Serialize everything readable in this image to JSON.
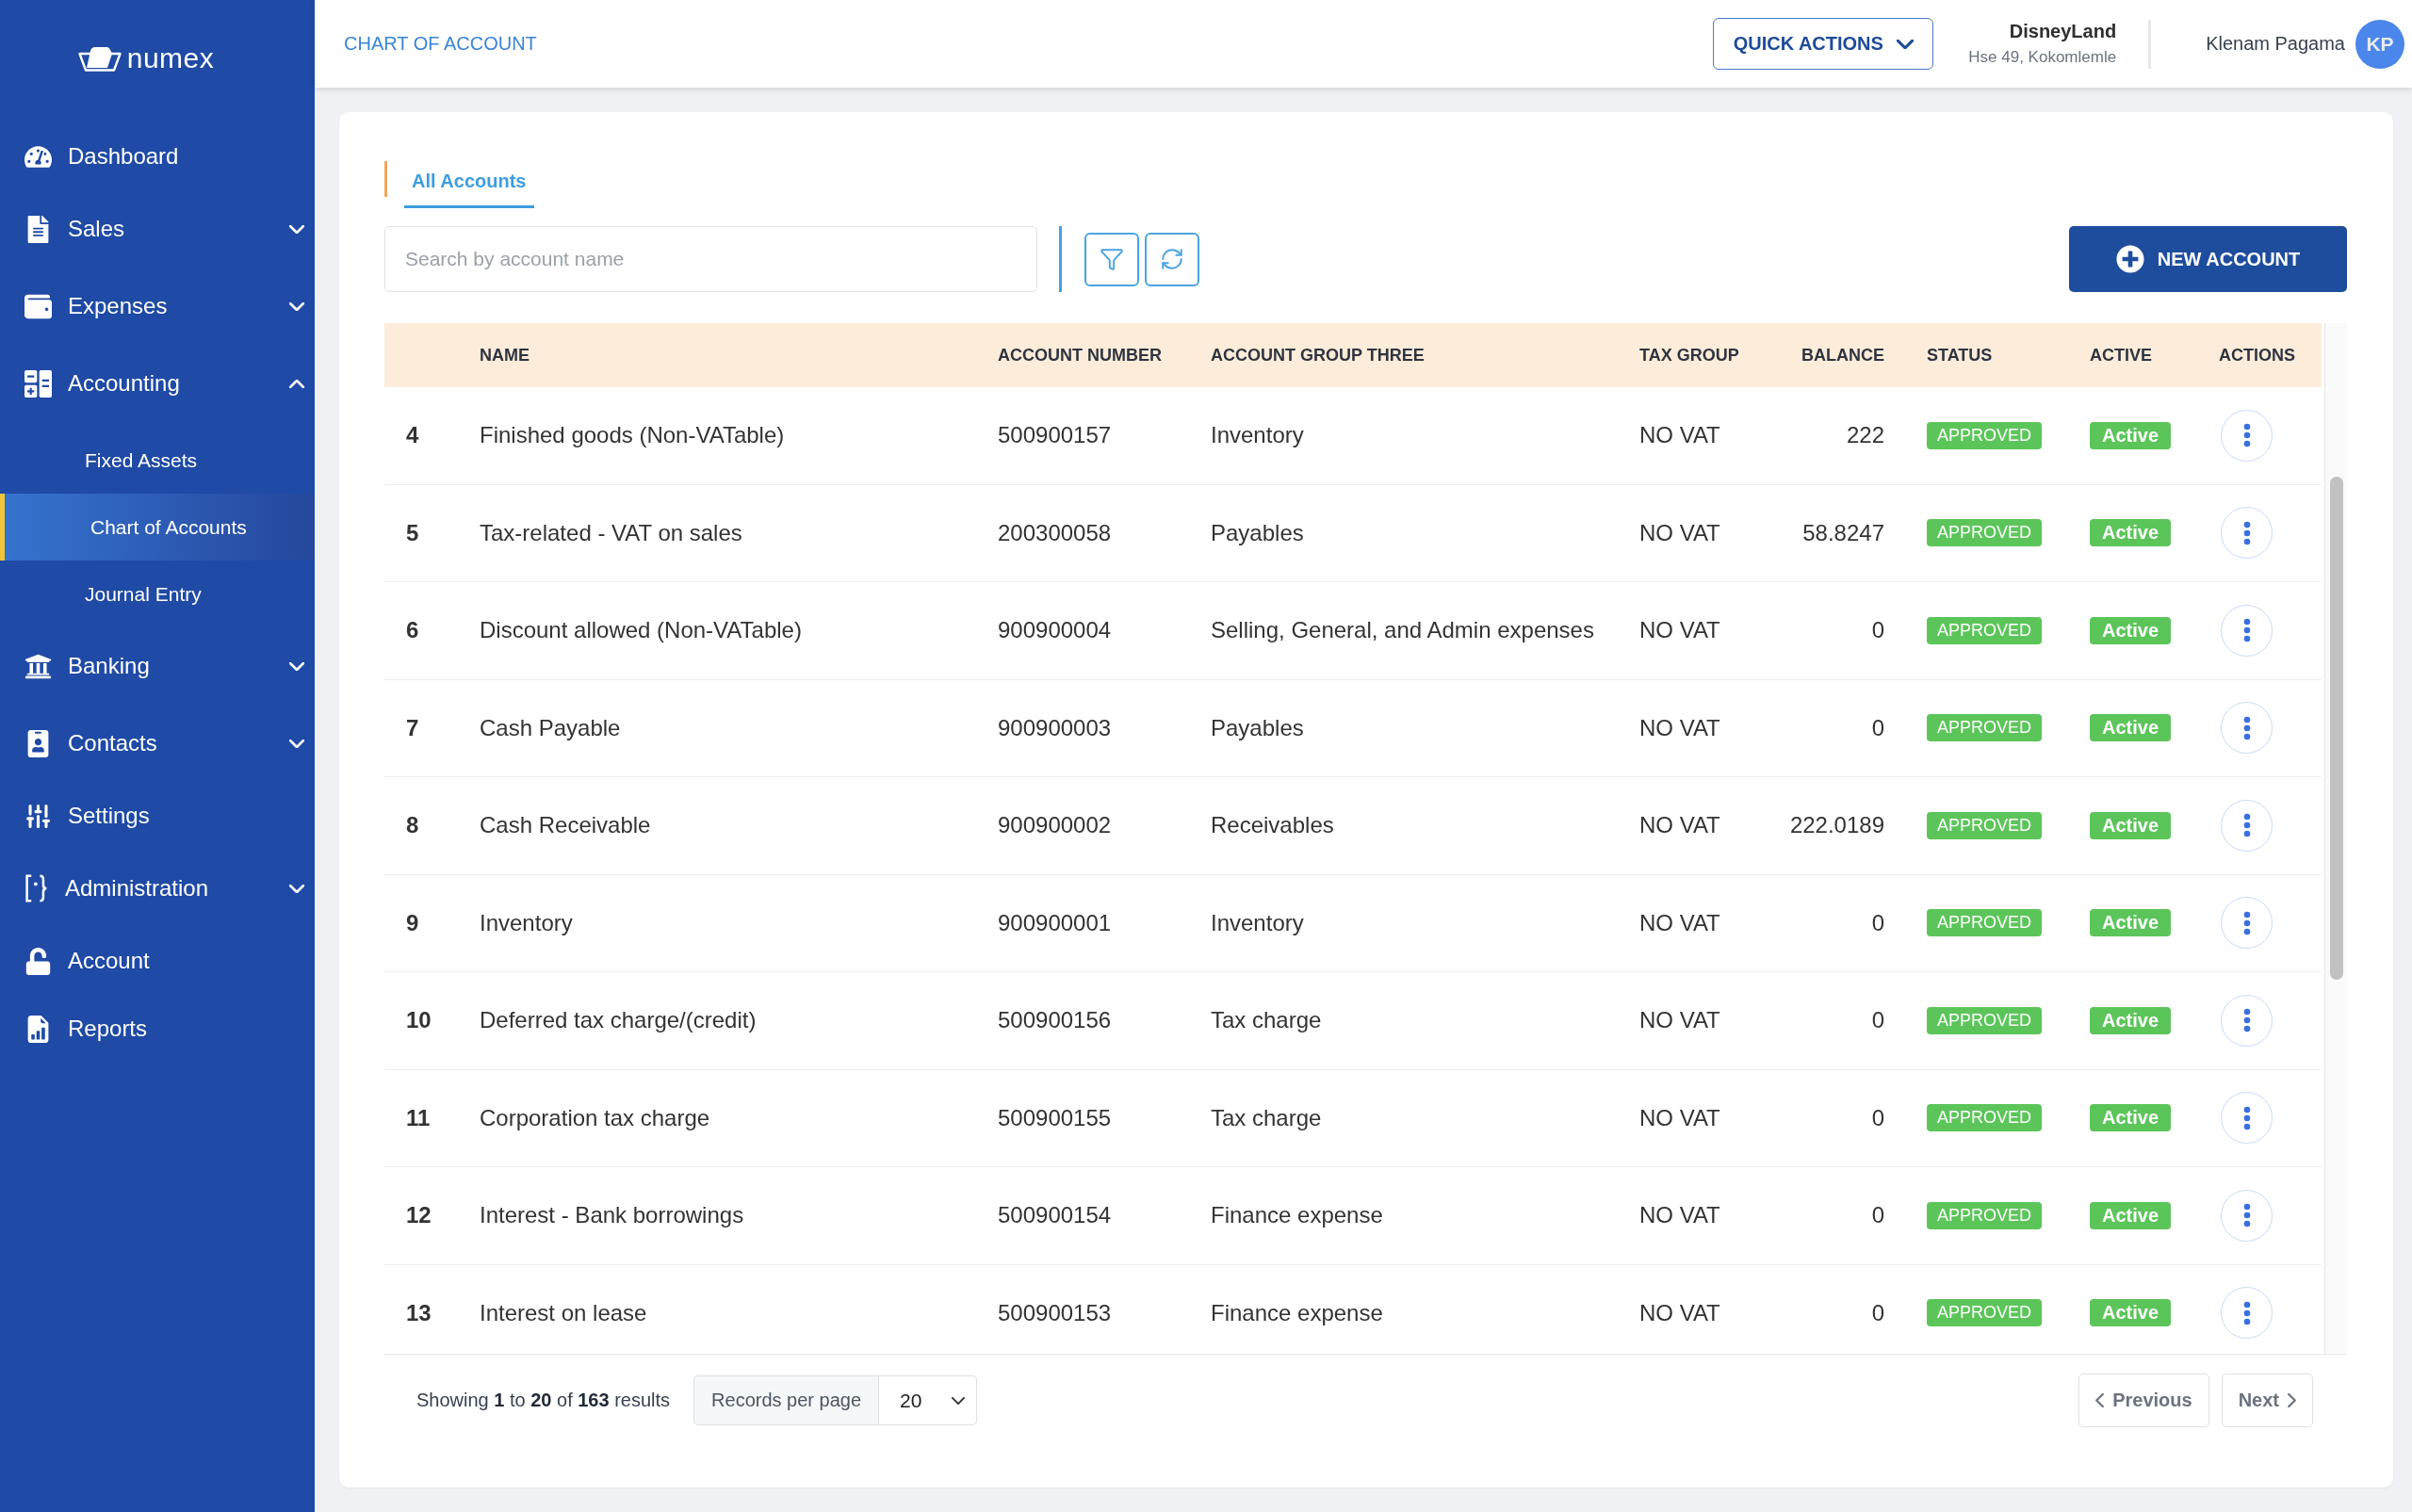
{
  "sidebar": {
    "brand": "numex",
    "items": [
      {
        "label": "Dashboard",
        "kind": "link"
      },
      {
        "label": "Sales",
        "kind": "group",
        "expanded": false
      },
      {
        "label": "Expenses",
        "kind": "group",
        "expanded": false
      },
      {
        "label": "Accounting",
        "kind": "group",
        "expanded": true,
        "children": [
          {
            "label": "Fixed Assets",
            "selected": false
          },
          {
            "label": "Chart of Accounts",
            "selected": true
          },
          {
            "label": "Journal Entry",
            "selected": false
          }
        ]
      },
      {
        "label": "Banking",
        "kind": "group",
        "expanded": false
      },
      {
        "label": "Contacts",
        "kind": "group",
        "expanded": false
      },
      {
        "label": "Settings",
        "kind": "link"
      },
      {
        "label": "Administration",
        "kind": "group",
        "expanded": false
      },
      {
        "label": "Account",
        "kind": "link"
      },
      {
        "label": "Reports",
        "kind": "link"
      }
    ]
  },
  "header": {
    "title": "CHART OF ACCOUNT",
    "quick_actions": "QUICK ACTIONS",
    "company": {
      "name": "DisneyLand",
      "address": "Hse 49, Kokomlemle"
    },
    "user": {
      "name": "Klenam Pagama",
      "initials": "KP"
    }
  },
  "tabs": [
    {
      "label": "All Accounts",
      "selected": true
    }
  ],
  "search": {
    "placeholder": "Search by account name"
  },
  "new_account_button": "NEW ACCOUNT",
  "table": {
    "columns": [
      "NAME",
      "ACCOUNT NUMBER",
      "ACCOUNT GROUP THREE",
      "TAX GROUP",
      "BALANCE",
      "STATUS",
      "ACTIVE",
      "ACTIONS"
    ],
    "rows": [
      {
        "number": "4",
        "name": "Finished goods (Non-VATable)",
        "account_number": "500900157",
        "account_group_three": "Inventory",
        "tax_group": "NO VAT",
        "balance": "222",
        "status": "APPROVED",
        "active": "Active"
      },
      {
        "number": "5",
        "name": "Tax-related - VAT on sales",
        "account_number": "200300058",
        "account_group_three": "Payables",
        "tax_group": "NO VAT",
        "balance": "58.8247",
        "status": "APPROVED",
        "active": "Active"
      },
      {
        "number": "6",
        "name": "Discount allowed (Non-VATable)",
        "account_number": "900900004",
        "account_group_three": "Selling, General, and Admin expenses",
        "tax_group": "NO VAT",
        "balance": "0",
        "status": "APPROVED",
        "active": "Active"
      },
      {
        "number": "7",
        "name": "Cash Payable",
        "account_number": "900900003",
        "account_group_three": "Payables",
        "tax_group": "NO VAT",
        "balance": "0",
        "status": "APPROVED",
        "active": "Active"
      },
      {
        "number": "8",
        "name": "Cash Receivable",
        "account_number": "900900002",
        "account_group_three": "Receivables",
        "tax_group": "NO VAT",
        "balance": "222.0189",
        "status": "APPROVED",
        "active": "Active"
      },
      {
        "number": "9",
        "name": "Inventory",
        "account_number": "900900001",
        "account_group_three": "Inventory",
        "tax_group": "NO VAT",
        "balance": "0",
        "status": "APPROVED",
        "active": "Active"
      },
      {
        "number": "10",
        "name": "Deferred tax charge/(credit)",
        "account_number": "500900156",
        "account_group_three": "Tax charge",
        "tax_group": "NO VAT",
        "balance": "0",
        "status": "APPROVED",
        "active": "Active"
      },
      {
        "number": "11",
        "name": "Corporation tax charge",
        "account_number": "500900155",
        "account_group_three": "Tax charge",
        "tax_group": "NO VAT",
        "balance": "0",
        "status": "APPROVED",
        "active": "Active"
      },
      {
        "number": "12",
        "name": "Interest - Bank borrowings",
        "account_number": "500900154",
        "account_group_three": "Finance expense",
        "tax_group": "NO VAT",
        "balance": "0",
        "status": "APPROVED",
        "active": "Active"
      },
      {
        "number": "13",
        "name": "Interest on lease",
        "account_number": "500900153",
        "account_group_three": "Finance expense",
        "tax_group": "NO VAT",
        "balance": "0",
        "status": "APPROVED",
        "active": "Active"
      }
    ]
  },
  "pagination": {
    "summary": "Showing **1** to **20** of **163** results",
    "records_per_page": {
      "label": "Records per page",
      "value": "20"
    },
    "previous": "Previous",
    "next": "Next"
  }
}
